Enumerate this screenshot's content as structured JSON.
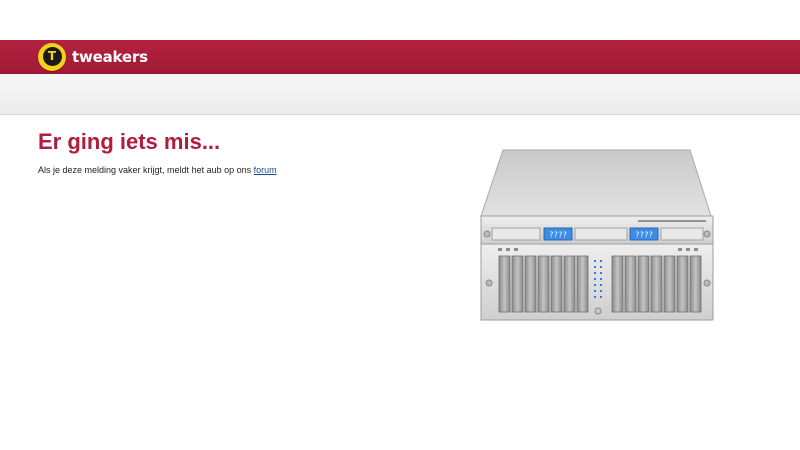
{
  "header": {
    "logo_letter": "T",
    "logo_text": "tweakers",
    "brand_color": "#a81c3a",
    "logo_badge_color": "#f2d21a"
  },
  "error": {
    "title": "Er ging iets mis...",
    "message_prefix": "Als je deze melding vaker krijgt, meldt het aub op ons",
    "link_text": "forum",
    "title_color": "#b01e3e"
  },
  "illustration": {
    "type": "server-rack-icon",
    "drive_label_left": "????",
    "drive_label_right": "????"
  }
}
